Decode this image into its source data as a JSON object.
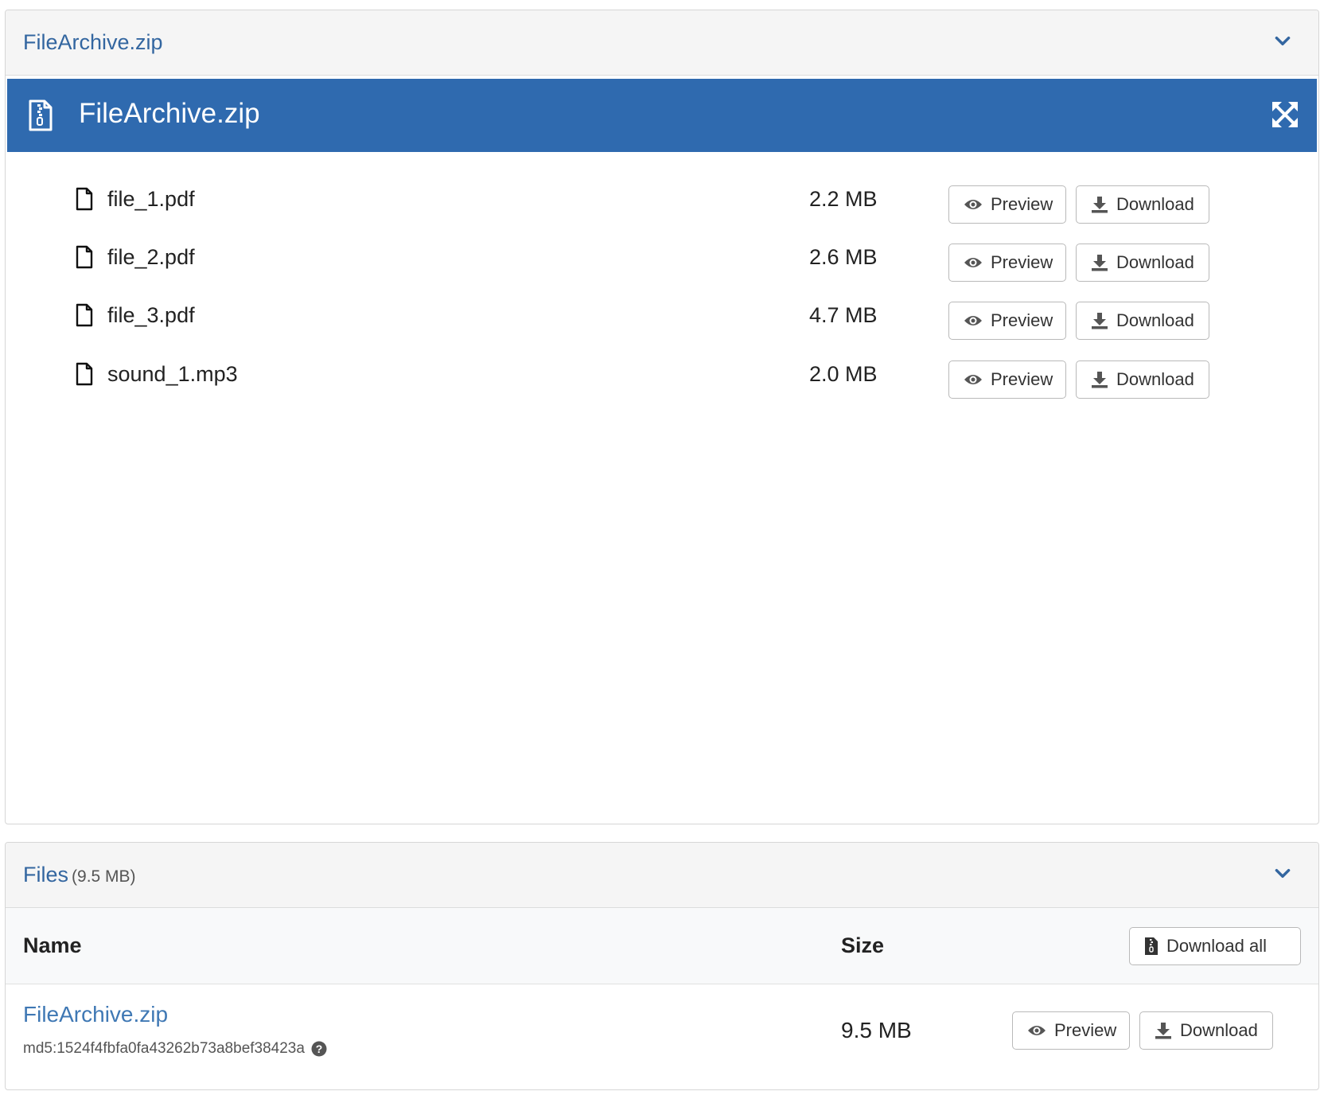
{
  "archive_panel": {
    "header_title": "FileArchive.zip",
    "preview_title": "FileArchive.zip",
    "files": [
      {
        "name": "file_1.pdf",
        "size": "2.2 MB"
      },
      {
        "name": "file_2.pdf",
        "size": "2.6 MB"
      },
      {
        "name": "file_3.pdf",
        "size": "4.7 MB"
      },
      {
        "name": "sound_1.mp3",
        "size": "2.0 MB"
      }
    ],
    "preview_label": "Preview",
    "download_label": "Download"
  },
  "files_panel": {
    "title": "Files",
    "total_size": "(9.5 MB)",
    "col_name": "Name",
    "col_size": "Size",
    "download_all_label": "Download all",
    "row": {
      "name": "FileArchive.zip",
      "checksum": "md5:1524f4fbfa0fa43262b73a8bef38423a",
      "size": "9.5 MB"
    },
    "preview_label": "Preview",
    "download_label": "Download"
  },
  "colors": {
    "header_blue": "#2f6aaf",
    "link_blue": "#3366a0",
    "panel_bg": "#f5f5f5"
  },
  "icons": [
    "chevron-down-icon",
    "zip-file-icon",
    "expand-icon",
    "file-icon",
    "eye-icon",
    "download-icon",
    "question-circle-icon"
  ]
}
